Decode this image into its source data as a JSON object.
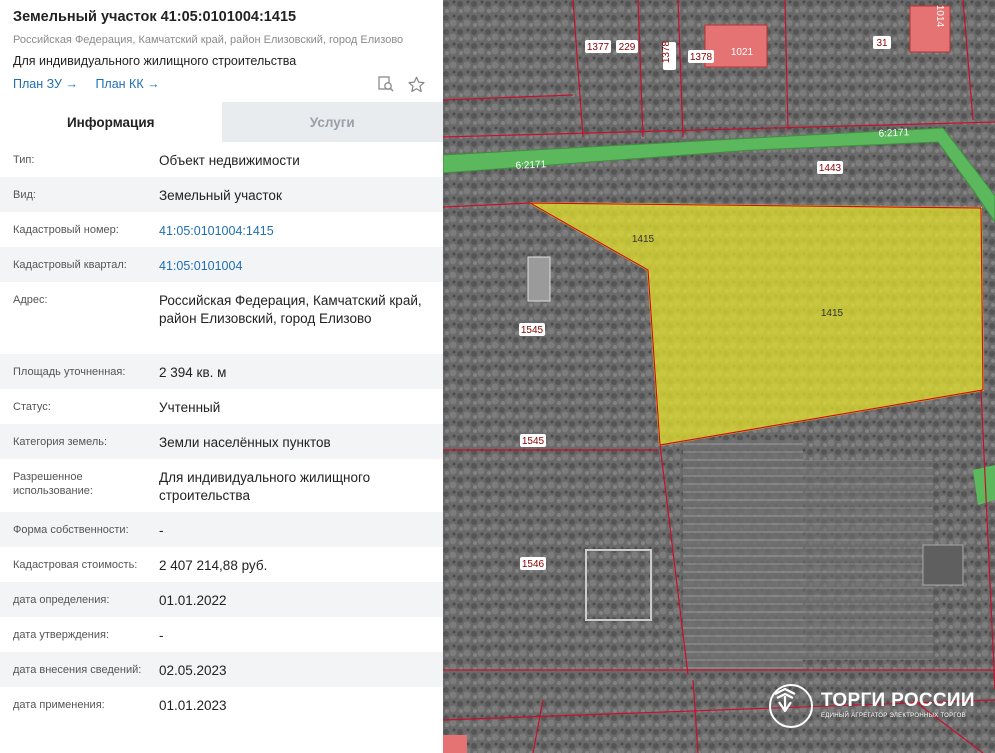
{
  "header": {
    "title": "Земельный участок 41:05:0101004:1415",
    "address": "Российская Федерация, Камчатский край, район Елизовский, город Елизово",
    "use": "Для индивидуального жилищного строительства",
    "link_plan_zu": "План ЗУ",
    "link_plan_kk": "План КК",
    "arrow": "→"
  },
  "tabs": [
    {
      "label": "Информация",
      "active": true
    },
    {
      "label": "Услуги",
      "active": false
    }
  ],
  "rows": [
    {
      "label": "Тип:",
      "value": "Объект недвижимости"
    },
    {
      "label": "Вид:",
      "value": "Земельный участок"
    },
    {
      "label": "Кадастровый номер:",
      "value": "41:05:0101004:1415"
    },
    {
      "label": "Кадастровый квартал:",
      "value": "41:05:0101004"
    },
    {
      "label": "Адрес:",
      "value": "Российская Федерация, Камчатский край, район Елизовский, город Елизово"
    },
    {
      "label": "Площадь уточненная:",
      "value": "2 394 кв. м"
    },
    {
      "label": "Статус:",
      "value": "Учтенный"
    },
    {
      "label": "Категория земель:",
      "value": "Земли населённых пунктов"
    },
    {
      "label": "Разрешенное использование:",
      "value": "Для индивидуального жилищного строительства"
    },
    {
      "label": "Форма собственности:",
      "value": "-"
    },
    {
      "label": "Кадастровая стоимость:",
      "value": "2 407 214,88 руб."
    },
    {
      "label": "дата определения:",
      "value": "01.01.2022"
    },
    {
      "label": "дата утверждения:",
      "value": "-"
    },
    {
      "label": "дата внесения сведений:",
      "value": "02.05.2023"
    },
    {
      "label": "дата применения:",
      "value": "01.01.2023"
    }
  ],
  "map": {
    "parcel_labels": [
      "1377",
      "229",
      "1378",
      "1378",
      "1021",
      "31",
      "1014",
      "6:2171",
      "6:2171",
      "1443",
      "1415",
      "1415",
      "1545",
      "1545",
      "1546"
    ],
    "colors": {
      "highlight": "#e8e42a",
      "boundary": "#c8102e",
      "road": "#4caf50",
      "building": "#e57373"
    }
  },
  "logo": {
    "title": "ТОРГИ РОССИИ",
    "subtitle": "ЕДИНЫЙ АГРЕГАТОР ЭЛЕКТРОННЫХ ТОРГОВ"
  }
}
